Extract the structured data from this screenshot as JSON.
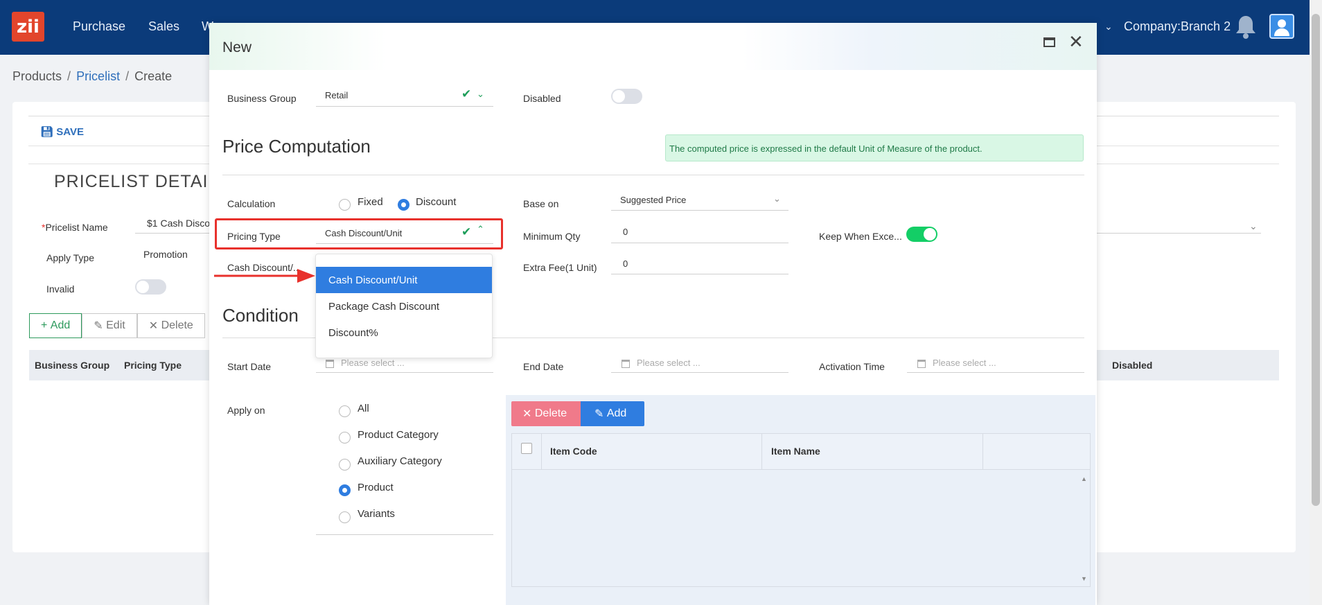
{
  "nav": {
    "logo": "zii",
    "items": [
      "Purchase",
      "Sales",
      "W"
    ],
    "company": "Company:Branch 2"
  },
  "breadcrumb": [
    "Products",
    "Pricelist",
    "Create"
  ],
  "background_page": {
    "save_label": "SAVE",
    "section_title": "PRICELIST DETAIL",
    "pricelist_name_label": "Pricelist Name",
    "pricelist_name_value": "$1 Cash Discou",
    "apply_type_label": "Apply Type",
    "apply_type_value": "Promotion",
    "invalid_label": "Invalid",
    "buttons": {
      "add": "Add",
      "edit": "Edit",
      "delete": "Delete"
    },
    "columns": {
      "business_group": "Business Group",
      "pricing_type": "Pricing Type",
      "disabled": "Disabled"
    }
  },
  "modal": {
    "title": "New",
    "business_group_label": "Business Group",
    "business_group_value": "Retail",
    "disabled_label": "Disabled",
    "price_computation_title": "Price Computation",
    "info_text": "The computed price is expressed in the default Unit of Measure of the product.",
    "calculation_label": "Calculation",
    "calc_options": [
      "Fixed",
      "Discount"
    ],
    "base_on_label": "Base on",
    "base_on_value": "Suggested Price",
    "pricing_type_label": "Pricing Type",
    "pricing_type_value": "Cash Discount/Unit",
    "minimum_qty_label": "Minimum Qty",
    "minimum_qty_value": "0",
    "keep_when_label": "Keep When Exce...",
    "cash_discount_label": "Cash Discount/...",
    "extra_fee_label": "Extra Fee(1 Unit)",
    "extra_fee_value": "0",
    "dropdown_options": [
      "Cash Discount/Unit",
      "Package Cash Discount",
      "Discount%"
    ],
    "condition_title": "Condition",
    "start_date_label": "Start Date",
    "end_date_label": "End Date",
    "activation_time_label": "Activation Time",
    "date_placeholder": "Please select ...",
    "apply_on_label": "Apply on",
    "apply_on_options": [
      "All",
      "Product Category",
      "Auxiliary Category",
      "Product",
      "Variants"
    ],
    "grid_buttons": {
      "delete": "Delete",
      "add": "Add"
    },
    "grid_columns": {
      "item_code": "Item Code",
      "item_name": "Item Name"
    }
  },
  "colors": {
    "nav_bg": "#0b3b7a",
    "accent": "#2f7de0",
    "success": "#13ce66",
    "danger": "#f07a8a",
    "highlight": "#e8312c"
  }
}
